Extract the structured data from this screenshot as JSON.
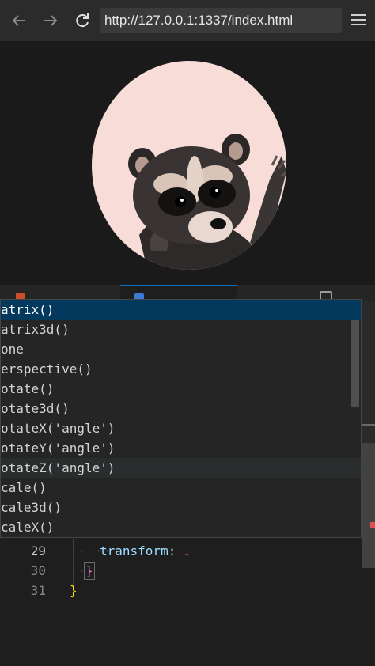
{
  "browser": {
    "back_icon": "arrow-left-icon",
    "forward_icon": "arrow-right-icon",
    "reload_icon": "reload-icon",
    "url": "http://127.0.0.1:1337/index.html",
    "menu_icon": "hamburger-menu-icon"
  },
  "page": {
    "avatar": "raccoon-image",
    "avatar_bg": "#f7dcd7"
  },
  "editor": {
    "suggestions": [
      {
        "label": "atrix()",
        "state": "selected"
      },
      {
        "label": "atrix3d()",
        "state": "normal"
      },
      {
        "label": "one",
        "state": "normal"
      },
      {
        "label": "erspective()",
        "state": "normal"
      },
      {
        "label": "otate()",
        "state": "normal"
      },
      {
        "label": "otate3d()",
        "state": "normal"
      },
      {
        "label": "otateX('angle')",
        "state": "normal"
      },
      {
        "label": "otateY('angle')",
        "state": "normal"
      },
      {
        "label": "otateZ('angle')",
        "state": "hover"
      },
      {
        "label": "cale()",
        "state": "normal"
      },
      {
        "label": "cale3d()",
        "state": "normal"
      },
      {
        "label": "caleX()",
        "state": "normal"
      }
    ],
    "lines": [
      {
        "number": "29",
        "property": "transform",
        "colon": ":"
      },
      {
        "number": "30",
        "text": "}"
      },
      {
        "number": "31",
        "text": "}"
      }
    ],
    "colors": {
      "selected_bg": "#04395e",
      "property": "#9cdcfe",
      "inner_brace": "#da70d6",
      "outer_brace": "#ffd700"
    }
  }
}
